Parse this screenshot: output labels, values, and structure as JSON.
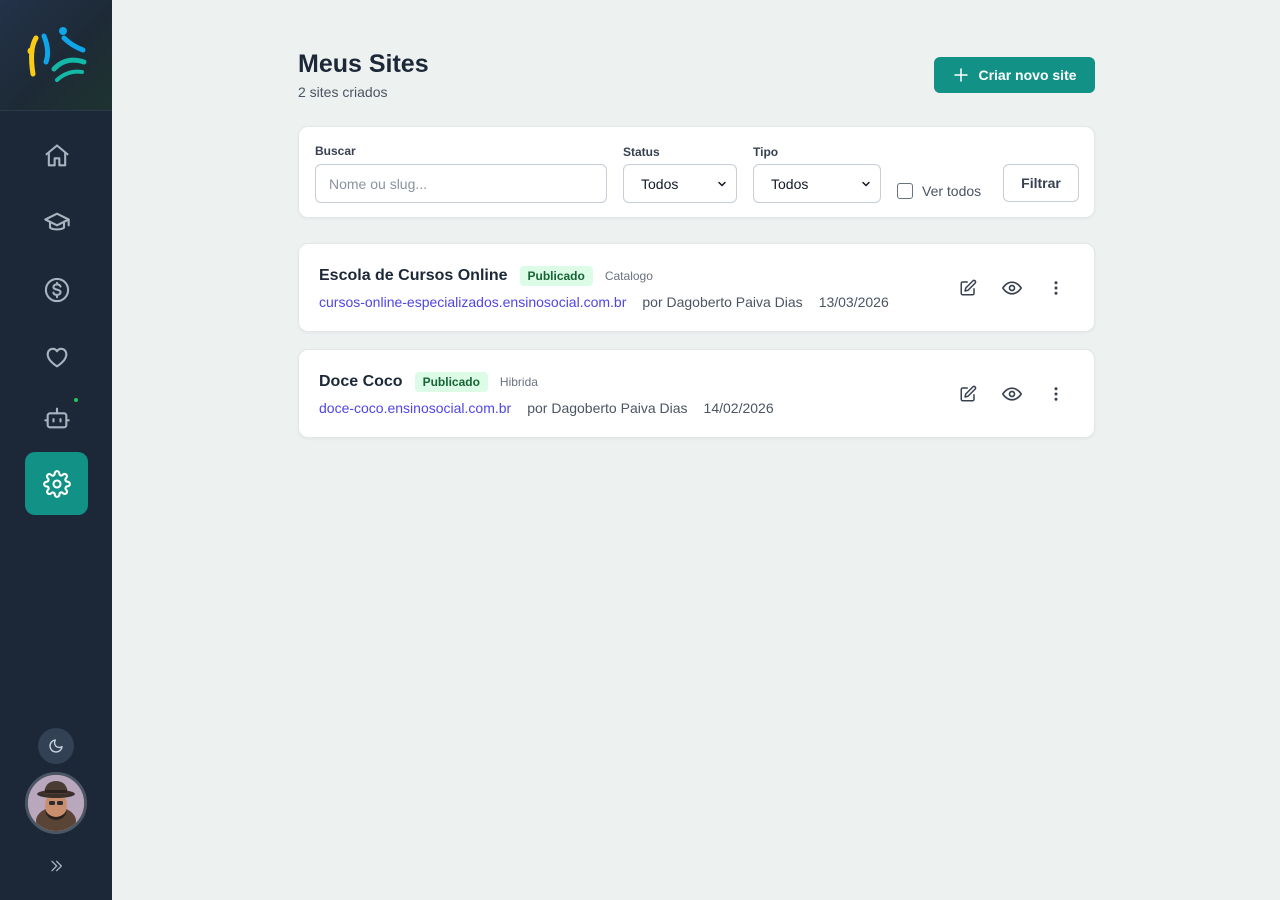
{
  "header": {
    "title": "Meus Sites",
    "subtitle": "2 sites criados",
    "create_button": "Criar novo site"
  },
  "filters": {
    "search_label": "Buscar",
    "search_placeholder": "Nome ou slug...",
    "search_value": "",
    "status_label": "Status",
    "status_value": "Todos",
    "type_label": "Tipo",
    "type_value": "Todos",
    "show_all_label": "Ver todos",
    "show_all_checked": false,
    "filter_button": "Filtrar"
  },
  "sites": [
    {
      "name": "Escola de Cursos Online",
      "status": "Publicado",
      "type": "Catalogo",
      "url": "cursos-online-especializados.ensinosocial.com.br",
      "author": "por Dagoberto Paiva Dias",
      "date": "13/03/2026"
    },
    {
      "name": "Doce Coco",
      "status": "Publicado",
      "type": "Hibrida",
      "url": "doce-coco.ensinosocial.com.br",
      "author": "por Dagoberto Paiva Dias",
      "date": "14/02/2026"
    }
  ],
  "sidebar": {
    "items": [
      {
        "icon": "home-icon"
      },
      {
        "icon": "graduation-cap-icon"
      },
      {
        "icon": "dollar-icon"
      },
      {
        "icon": "heart-icon"
      },
      {
        "icon": "bot-icon"
      },
      {
        "icon": "settings-icon",
        "active": true
      }
    ]
  },
  "colors": {
    "accent": "#129186",
    "sidebar_bg": "#1c2837",
    "link": "#4f46e5",
    "badge_bg": "#dcfce7",
    "badge_text": "#166534"
  }
}
